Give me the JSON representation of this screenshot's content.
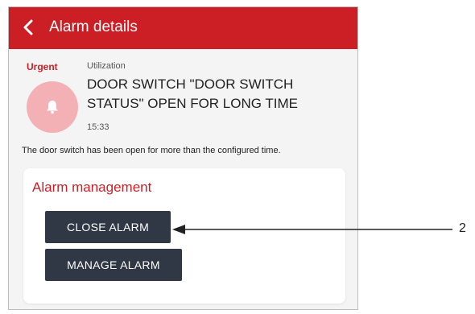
{
  "header": {
    "title": "Alarm details",
    "back_icon": "chevron-left-icon"
  },
  "alarm": {
    "priority": "Urgent",
    "category": "Utilization",
    "icon": "bell-icon",
    "title": "DOOR SWITCH \"DOOR SWITCH STATUS\" OPEN FOR LONG TIME",
    "time": "15:33",
    "description": "The door switch has been open for more than the configured time."
  },
  "management": {
    "heading": "Alarm management",
    "close_label": "CLOSE ALARM",
    "manage_label": "MANAGE ALARM"
  },
  "callout": {
    "number": "2"
  },
  "colors": {
    "accent": "#cc1f25",
    "button": "#2f3844",
    "bell_circle": "#f4b1b5"
  }
}
